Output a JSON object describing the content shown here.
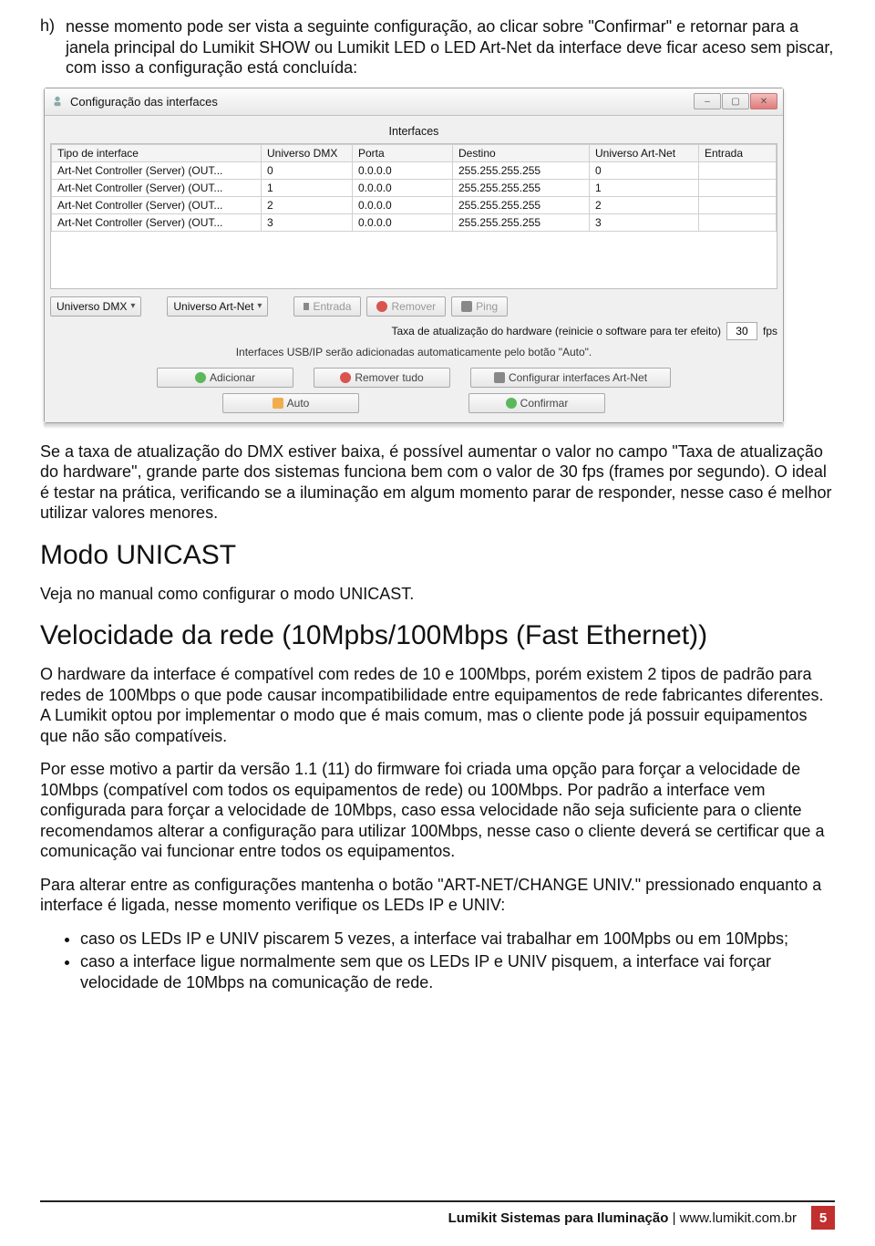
{
  "list_h": {
    "marker": "h)",
    "text": "nesse momento pode ser vista a seguinte configuração, ao clicar sobre \"Confirmar\" e retornar para a janela principal do Lumikit SHOW ou Lumikit LED o LED Art-Net da interface deve ficar aceso sem piscar, com isso a configuração está concluída:"
  },
  "window": {
    "title": "Configuração das interfaces",
    "subtitle": "Interfaces",
    "columns": [
      "Tipo de interface",
      "Universo DMX",
      "Porta",
      "Destino",
      "Universo Art-Net",
      "Entrada"
    ],
    "rows": [
      {
        "tipo": "Art-Net Controller (Server) (OUT...",
        "udmx": "0",
        "porta": "0.0.0.0",
        "dest": "255.255.255.255",
        "uan": "0",
        "ent": ""
      },
      {
        "tipo": "Art-Net Controller (Server) (OUT...",
        "udmx": "1",
        "porta": "0.0.0.0",
        "dest": "255.255.255.255",
        "uan": "1",
        "ent": ""
      },
      {
        "tipo": "Art-Net Controller (Server) (OUT...",
        "udmx": "2",
        "porta": "0.0.0.0",
        "dest": "255.255.255.255",
        "uan": "2",
        "ent": ""
      },
      {
        "tipo": "Art-Net Controller (Server) (OUT...",
        "udmx": "3",
        "porta": "0.0.0.0",
        "dest": "255.255.255.255",
        "uan": "3",
        "ent": ""
      }
    ],
    "dd_universo_dmx": "Universo DMX",
    "dd_universo_an": "Universo Art-Net",
    "btn_entrada": "Entrada",
    "btn_remover": "Remover",
    "btn_ping": "Ping",
    "fps_label_left": "Taxa de atualização do hardware (reinicie o software para ter efeito)",
    "fps_value": "30",
    "fps_unit": "fps",
    "hint_usb": "Interfaces USB/IP serão adicionadas automaticamente pelo botão \"Auto\".",
    "btn_adicionar": "Adicionar",
    "btn_remover_tudo": "Remover tudo",
    "btn_config_artnet": "Configurar interfaces Art-Net",
    "btn_auto": "Auto",
    "btn_confirmar": "Confirmar"
  },
  "para_taxa": "Se a taxa de atualização do DMX estiver baixa, é possível aumentar o valor no campo \"Taxa de atualização do hardware\", grande parte dos sistemas funciona bem com o valor de 30 fps (frames por segundo). O ideal é testar na prática, verificando se a iluminação em algum momento parar de responder, nesse caso é melhor utilizar valores menores.",
  "h_unicast": "Modo UNICAST",
  "para_unicast": "Veja no manual como configurar o modo UNICAST.",
  "h_velocidade": "Velocidade da rede (10Mpbs/100Mbps (Fast Ethernet))",
  "para_vel1": "O hardware da interface é compatível com redes de 10 e 100Mbps, porém existem 2 tipos de padrão para redes de 100Mbps o que pode causar incompatibilidade entre equipamentos de rede fabricantes diferentes. A Lumikit optou por implementar o modo que é mais comum, mas o cliente pode já possuir equipamentos que não são compatíveis.",
  "para_vel2": "Por esse motivo a partir da versão 1.1 (11) do firmware foi criada uma opção para forçar a velocidade de 10Mbps (compatível com todos os equipamentos de rede) ou 100Mbps. Por padrão a interface vem configurada para forçar a velocidade de 10Mbps, caso essa velocidade não seja suficiente para o cliente recomendamos alterar a configuração para utilizar 100Mbps, nesse caso o cliente deverá se certificar que a comunicação vai funcionar entre todos os equipamentos.",
  "para_vel3": "Para alterar entre as configurações mantenha o botão \"ART-NET/CHANGE UNIV.\" pressionado enquanto a interface é ligada, nesse momento verifique os LEDs IP e UNIV:",
  "bullets": [
    "caso os LEDs IP e UNIV piscarem 5 vezes, a interface vai trabalhar em 100Mpbs ou em 10Mpbs;",
    "caso a interface ligue normalmente sem que os LEDs IP e UNIV pisquem, a interface vai forçar velocidade de 10Mbps na comunicação de rede."
  ],
  "footer": {
    "brand": "Lumikit Sistemas para Iluminação",
    "sep": " | ",
    "url": "www.lumikit.com.br",
    "page": "5"
  }
}
